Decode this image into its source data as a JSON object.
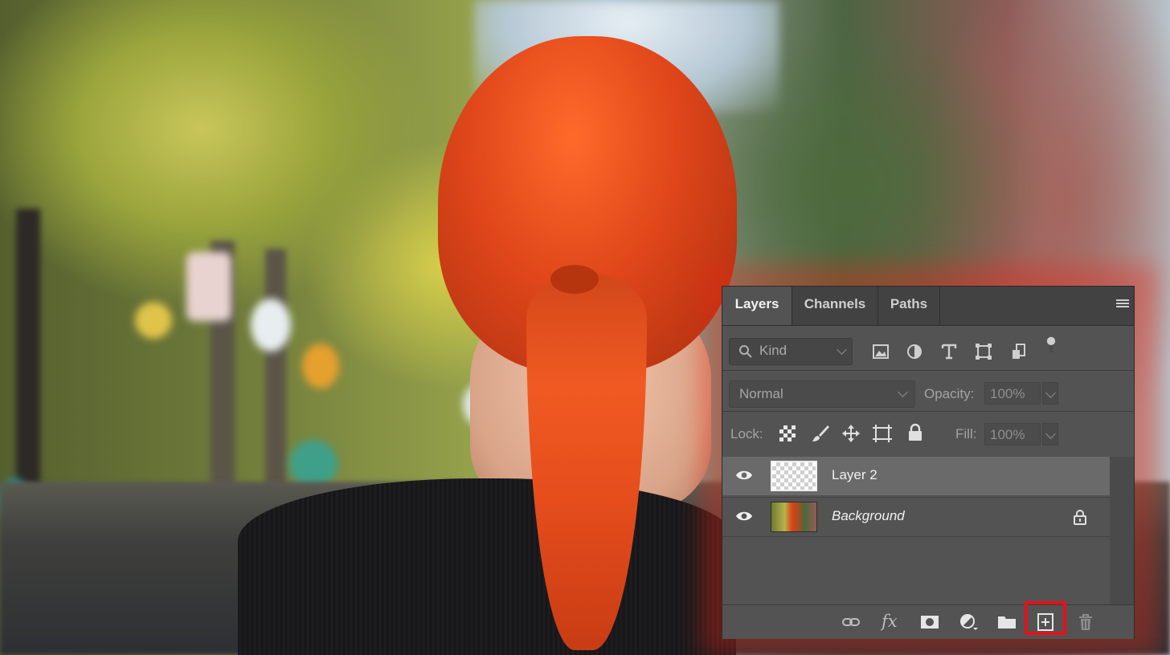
{
  "panel": {
    "tabs": [
      {
        "label": "Layers",
        "active": true
      },
      {
        "label": "Channels",
        "active": false
      },
      {
        "label": "Paths",
        "active": false
      }
    ],
    "filter": {
      "kind_placeholder": "Kind",
      "icons": [
        "image-filter-icon",
        "adjustment-filter-icon",
        "type-filter-icon",
        "shape-filter-icon",
        "smart-object-filter-icon",
        "filter-toggle-icon"
      ]
    },
    "blend": {
      "mode": "Normal",
      "opacity_label": "Opacity:",
      "opacity_value": "100%"
    },
    "lock": {
      "label": "Lock:",
      "fill_label": "Fill:",
      "fill_value": "100%",
      "icons": [
        "lock-transparent-icon",
        "lock-image-icon",
        "lock-position-icon",
        "lock-artboard-icon",
        "lock-all-icon"
      ]
    },
    "layers": [
      {
        "name": "Layer 2",
        "selected": true,
        "visible": true,
        "locked": false
      },
      {
        "name": "Background",
        "selected": false,
        "visible": true,
        "locked": true
      }
    ],
    "footer_icons": [
      "link-layers-icon",
      "fx-icon",
      "add-mask-icon",
      "adjustment-layer-icon",
      "new-group-icon",
      "new-layer-icon",
      "delete-layer-icon"
    ],
    "fx_text": "fx",
    "highlighted_control": "new-layer-icon",
    "colors": {
      "highlight": "#e4121a",
      "panel_bg": "#535353",
      "tab_bar": "#424242",
      "selected_row": "#6a6a6a"
    }
  }
}
